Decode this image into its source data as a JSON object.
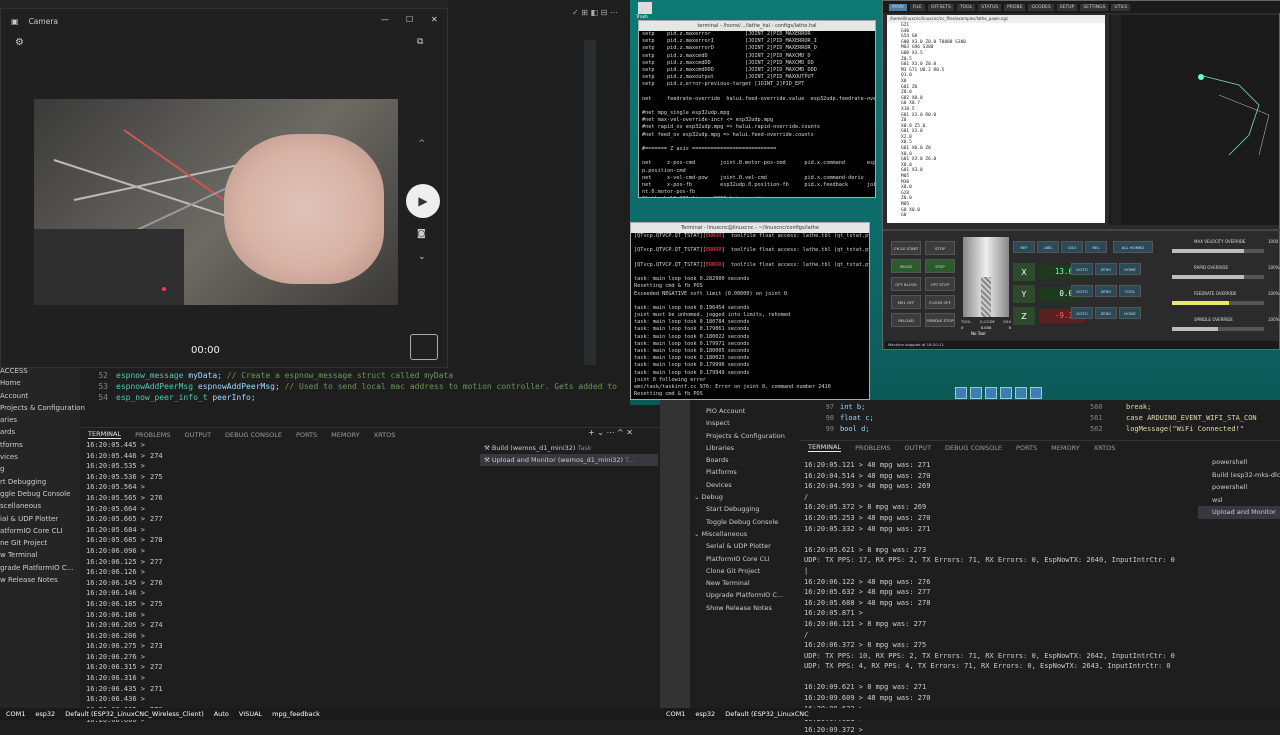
{
  "camera": {
    "title": "Camera",
    "timer": "00:00"
  },
  "left_sidebar": [
    "ACCESS",
    "Home",
    "Account",
    "Projects & Configuration",
    "aries",
    "ards",
    "tforms",
    "vices",
    "g",
    "rt Debugging",
    "ggle Debug Console",
    "scellaneous",
    "ial & UDP Plotter",
    "atformIO Core CLI",
    "ne Git Project",
    "w Terminal",
    "grade PlatformIO C...",
    "w Release Notes"
  ],
  "left_code": {
    "lines": [
      {
        "n": "52",
        "type": "espnow_message",
        "name": "myData",
        "comment": "// Create a espnow_message struct called myData"
      },
      {
        "n": "53",
        "type": "espnowAddPeerMsg",
        "name": "espnowAddPeerMsg",
        "comment": "// Used to send local mac address to motion controller. Gets added to"
      },
      {
        "n": "54",
        "type": "esp_now_peer_info_t",
        "name": "peerInfo",
        "comment": ""
      }
    ]
  },
  "left_panel_tabs": [
    "TERMINAL",
    "PROBLEMS",
    "OUTPUT",
    "DEBUG CONSOLE",
    "PORTS",
    "MEMORY",
    "XRTOS"
  ],
  "left_terminal": [
    {
      "t": "16:20:05.445 >",
      "v": ""
    },
    {
      "t": "16:20:05.446 >",
      "v": "274"
    },
    {
      "t": "16:20:05.535 >",
      "v": ""
    },
    {
      "t": "16:20:05.536 >",
      "v": "275"
    },
    {
      "t": "16:20:05.564 >",
      "v": ""
    },
    {
      "t": "16:20:05.565 >",
      "v": "276"
    },
    {
      "t": "16:20:05.664 >",
      "v": ""
    },
    {
      "t": "16:20:05.665 >",
      "v": "277"
    },
    {
      "t": "16:20:05.684 >",
      "v": ""
    },
    {
      "t": "16:20:05.685 >",
      "v": "278"
    },
    {
      "t": "16:20:06.096 >",
      "v": ""
    },
    {
      "t": "16:20:06.125 >",
      "v": "277"
    },
    {
      "t": "16:20:06.126 >",
      "v": ""
    },
    {
      "t": "16:20:06.145 >",
      "v": "276"
    },
    {
      "t": "16:20:06.146 >",
      "v": ""
    },
    {
      "t": "16:20:06.185 >",
      "v": "275"
    },
    {
      "t": "16:20:06.186 >",
      "v": ""
    },
    {
      "t": "16:20:06.205 >",
      "v": "274"
    },
    {
      "t": "16:20:06.206 >",
      "v": ""
    },
    {
      "t": "16:20:06.275 >",
      "v": "273"
    },
    {
      "t": "16:20:06.276 >",
      "v": ""
    },
    {
      "t": "16:20:06.315 >",
      "v": "272"
    },
    {
      "t": "16:20:06.316 >",
      "v": ""
    },
    {
      "t": "16:20:06.435 >",
      "v": "271"
    },
    {
      "t": "16:20:06.436 >",
      "v": ""
    },
    {
      "t": "16:20:06.605 >",
      "v": "270"
    },
    {
      "t": "16:20:06.606 >",
      "v": ""
    }
  ],
  "left_terminal_list": [
    {
      "label": "Build (wemos_d1_mini32)",
      "suffix": "Task"
    },
    {
      "label": "Upload and Monitor (wemos_d1_mini32)",
      "suffix": "T..."
    }
  ],
  "left_status": [
    "COM1",
    "esp32",
    "Default (ESP32_LinuxCNC_Wireless_Client)",
    "Auto",
    "VISUAL",
    "mpg_feedback"
  ],
  "xterm_top": {
    "title": "terminal - /home/.../lathe_hal - configs/lathe.hal",
    "lines": [
      "setp    pid.z.maxerror           [JOINT_2]PID_MAXERROR",
      "setp    pid.z.maxerrorI          [JOINT_2]PID_MAXERROR_I",
      "setp    pid.z.maxerrorD          [JOINT_2]PID_MAXERROR_D",
      "setp    pid.z.maxcmdD            [JOINT_2]PID_MAXCMD_D",
      "setp    pid.z.maxcmdDD           [JOINT_2]PID_MAXCMD_DD",
      "setp    pid.z.maxcmdDDD          [JOINT_2]PID_MAXCMD_DDD",
      "setp    pid.z.maxoutput          [JOINT_2]PID_MAXOUTPUT",
      "setp    pid.z.error-previous-target [JOINT_2]PID_EPT",
      "",
      "net     feedrate-override  halui.feed-override.value  esp32udp.feedrate-ove",
      "",
      "#net mpg_single esp32udp.mpg",
      "#net max-vel-override-incr <= esp32udp.mpg",
      "#net rapid_ov esp32udp.mpg => halui.rapid-override.counts",
      "#net feed_ov esp32udp.mpg => halui.feed-override.counts",
      "",
      "#======= Z axis ===========================",
      "",
      "net     z-pos-cmd        joint.0.motor-pos-cmd      pid.x.command       esp32ud",
      "p.position-cmd",
      "net     x-vel-cmd-pow    joint.0.vel-cmd            pid.x.command-deriv",
      "net     x-pos-fb         esp32udp.0.position-fb     pid.x.feedback      joi",
      "nt.0.motor-pos-fb",
      "\"lathe.hal\" 201 lines, 8820 bytes written"
    ]
  },
  "xterm_bottom": {
    "title": "Terminal - linuxcnc@linuxcnc - ~/linuxcnc/configs/lathe",
    "lines": [
      {
        "pre": "[QTvcp.QTVCP.QT_TSTAT][",
        "red": "ERROR",
        "post": "]  toolfile float access: lathe.tbl (qt_tstat.py:173"
      },
      {
        "pre": "",
        "red": "",
        "post": ""
      },
      {
        "pre": "[QTvcp.QTVCP.QT_TSTAT][",
        "red": "ERROR",
        "post": "]  toolfile float access: lathe.tbl (qt_tstat.py:173"
      },
      {
        "pre": "",
        "red": "",
        "post": ""
      },
      {
        "pre": "[QTvcp.QTVCP.QT_TSTAT][",
        "red": "ERROR",
        "post": "]  toolfile float access: lathe.tbl (qt_tstat.py:173"
      },
      {
        "pre": "",
        "red": "",
        "post": ""
      },
      {
        "pre": "task: main loop took 0.282900 seconds",
        "red": "",
        "post": ""
      },
      {
        "pre": "Resetting cmd & fb POS",
        "red": "",
        "post": ""
      },
      {
        "pre": "Exceeded NEGATIVE soft limit (0.00000) on joint 0",
        "red": "",
        "post": ""
      },
      {
        "pre": "",
        "red": "",
        "post": ""
      },
      {
        "pre": "task: main loop took 0.196454 seconds",
        "red": "",
        "post": ""
      },
      {
        "pre": "joint must be unhomed, jogged into limits, rehomed",
        "red": "",
        "post": ""
      },
      {
        "pre": "task: main loop took 0.180784 seconds",
        "red": "",
        "post": ""
      },
      {
        "pre": "task: main loop took 0.179861 seconds",
        "red": "",
        "post": ""
      },
      {
        "pre": "task: main loop took 0.180022 seconds",
        "red": "",
        "post": ""
      },
      {
        "pre": "task: main loop took 0.179971 seconds",
        "red": "",
        "post": ""
      },
      {
        "pre": "task: main loop took 0.180005 seconds",
        "red": "",
        "post": ""
      },
      {
        "pre": "task: main loop took 0.180023 seconds",
        "red": "",
        "post": ""
      },
      {
        "pre": "task: main loop took 0.179996 seconds",
        "red": "",
        "post": ""
      },
      {
        "pre": "task: main loop took 0.179949 seconds",
        "red": "",
        "post": ""
      },
      {
        "pre": "joint 0 following error",
        "red": "",
        "post": ""
      },
      {
        "pre": "emc/task/taskintf.cc 976: Error on joint 0, command number 2410",
        "red": "",
        "post": ""
      },
      {
        "pre": "Resetting cmd & fb POS",
        "red": "",
        "post": ""
      }
    ]
  },
  "gui": {
    "nav": [
      "MAIN",
      "FILE",
      "OFFSETS",
      "TOOL",
      "STATUS",
      "PROBE",
      "GCODES",
      "SETUP",
      "SETTINGS",
      "UTILS"
    ],
    "gcode_path": "/home/linuxcnc/linuxcnc/nc_files/examples/lathe_pawn.ngc",
    "gcode": [
      "G21",
      "G40",
      "G54 G8",
      "G00 X3.0 Z0.0 T0808 S300",
      "M03 G96 S300",
      "G00 X3.5",
      "Z0.5",
      "G01 X3.0 Z0.0",
      "M3 G71 U0.2 R0.5",
      "Q1.0",
      "X0",
      "G01 Z0",
      "Z0.0",
      "G02 X0.0",
      "G0 X0.7",
      "X10.5",
      "G01 X3.0 R0.0",
      "Z0",
      "X0.8 Z5.0",
      "G01 X3.0",
      "X2.0",
      "X0.5",
      "G01 X0.0 Z0",
      "X0.0",
      "G01 X3.0 Z6.0",
      "X0.0",
      "G01 X3.0",
      "M05",
      "M30",
      "X0.0",
      "G28",
      "Z0.0",
      "M05",
      "G0 X0.0",
      "G0"
    ],
    "left_buttons": [
      "CYCLE START",
      "STOP",
      "PAUSE",
      "STEP",
      "OPT BLOCK",
      "OPT STOP",
      "M01 OFF",
      "FLOOD OFF",
      "RELOAD",
      "SPINDLE STOP"
    ],
    "tool_labels": {
      "tool": "TOOL",
      "g_code": "G-CODE",
      "gcs": "G54",
      "tool_val": "0",
      "gcode_val": "0.000",
      "gcs_val": "0",
      "status": "No Tool"
    },
    "dro": [
      {
        "axis": "X",
        "value": "13.650",
        "color": "#66ffcc"
      },
      {
        "axis": "Y",
        "value": "0.000",
        "color": "#ffffff"
      },
      {
        "axis": "Z",
        "value": "-9.336",
        "color": "#ff6666"
      }
    ],
    "mid_buttons": [
      "REF",
      "ABS",
      "G54",
      "REL",
      "ALL HOMED",
      "ZERO",
      "GOTO",
      "HOME",
      "ZERO",
      "GOTO",
      "TOOL",
      "ZERO",
      "GOTO",
      "HOME"
    ],
    "sliders": [
      {
        "label": "MAX VELOCITY OVERRIDE",
        "value": "1000",
        "level": 0.78
      },
      {
        "label": "RAPID OVERRIDE",
        "value": "100%",
        "level": 0.78
      },
      {
        "label": "FEEDRATE OVERRIDE",
        "value": "100%",
        "level": 0.62
      },
      {
        "label": "SPINDLE OVERRIDE",
        "value": "100%",
        "level": 0.5
      }
    ],
    "status_line": "Machine stopped at 16:20:11"
  },
  "right_sidebar": [
    {
      "label": "PIO Account",
      "hdr": false
    },
    {
      "label": "Inspect",
      "hdr": false
    },
    {
      "label": "Projects & Configuration",
      "hdr": false
    },
    {
      "label": "Libraries",
      "hdr": false
    },
    {
      "label": "Boards",
      "hdr": false
    },
    {
      "label": "Platforms",
      "hdr": false
    },
    {
      "label": "Devices",
      "hdr": false
    },
    {
      "label": "Debug",
      "hdr": true
    },
    {
      "label": "Start Debugging",
      "hdr": false
    },
    {
      "label": "Toggle Debug Console",
      "hdr": false
    },
    {
      "label": "Miscellaneous",
      "hdr": true
    },
    {
      "label": "Serial & UDP Plotter",
      "hdr": false
    },
    {
      "label": "PlatformIO Core CLI",
      "hdr": false
    },
    {
      "label": "Clone Git Project",
      "hdr": false
    },
    {
      "label": "New Terminal",
      "hdr": false
    },
    {
      "label": "Upgrade PlatformIO C...",
      "hdr": false
    },
    {
      "label": "Show Release Notes",
      "hdr": false
    }
  ],
  "right_code": [
    {
      "n": "97",
      "code": "int b;",
      "n2": "560",
      "code2": "break;"
    },
    {
      "n": "98",
      "code": "float c;",
      "n2": "561",
      "code2": "case ARDUINO_EVENT_WIFI_STA_CON"
    },
    {
      "n": "99",
      "code": "bool d;",
      "n2": "562",
      "code2": "logMessage(\"WiFi Connected!\""
    }
  ],
  "right_panel_tabs": [
    "TERMINAL",
    "PROBLEMS",
    "OUTPUT",
    "DEBUG CONSOLE",
    "PORTS",
    "MEMORY",
    "XRTOS"
  ],
  "right_terminal": [
    "16:20:05.121 > 48 mpg was: 271",
    "16:20:04.514 > 48 mpg was: 270",
    "16:20:04.593 > 48 mpg was: 269",
    "/",
    "16:20:05.372 > 8 mpg was: 269",
    "16:20:05.253 > 48 mpg was: 270",
    "16:20:05.332 > 48 mpg was: 271",
    "",
    "16:20:05.621 > 8 mpg was: 273",
    "UDP: TX PPS: 17, RX PPS: 2, TX Errors: 71, RX Errors: 0, EspNowTX: 2640, InputIntrCtr: 0",
    "|",
    "16:20:06.122 > 48 mpg was: 276",
    "16:20:05.632 > 48 mpg was: 277",
    "16:20:05.688 > 48 mpg was: 278",
    "16:20:05.871 >",
    "16:20:06.121 > 8 mpg was: 277",
    "/",
    "16:20:06.372 > 8 mpg was: 275",
    "UDP: TX PPS: 10, RX PPS: 2, TX Errors: 71, RX Errors: 0, EspNowTX: 2642, InputIntrCtr: 0",
    "UDP: TX PPS: 4, RX PPS: 4, TX Errors: 71, RX Errors: 0, EspNowTX: 2643, InputIntrCtr: 0",
    "",
    "16:20:09.621 > 8 mpg was: 271",
    "16:20:09.609 > 48 mpg was: 270",
    "16:20:09.622 >",
    "16:20:07.621 >",
    "16:20:09.372 >"
  ],
  "right_terminal_list": [
    "powershell",
    "Build (esp32-mks-dlc",
    "powershell",
    "wsl",
    "Upload and Monitor"
  ],
  "right_status": [
    "COM1",
    "esp32",
    "Default (ESP32_LinuxCNC"
  ]
}
